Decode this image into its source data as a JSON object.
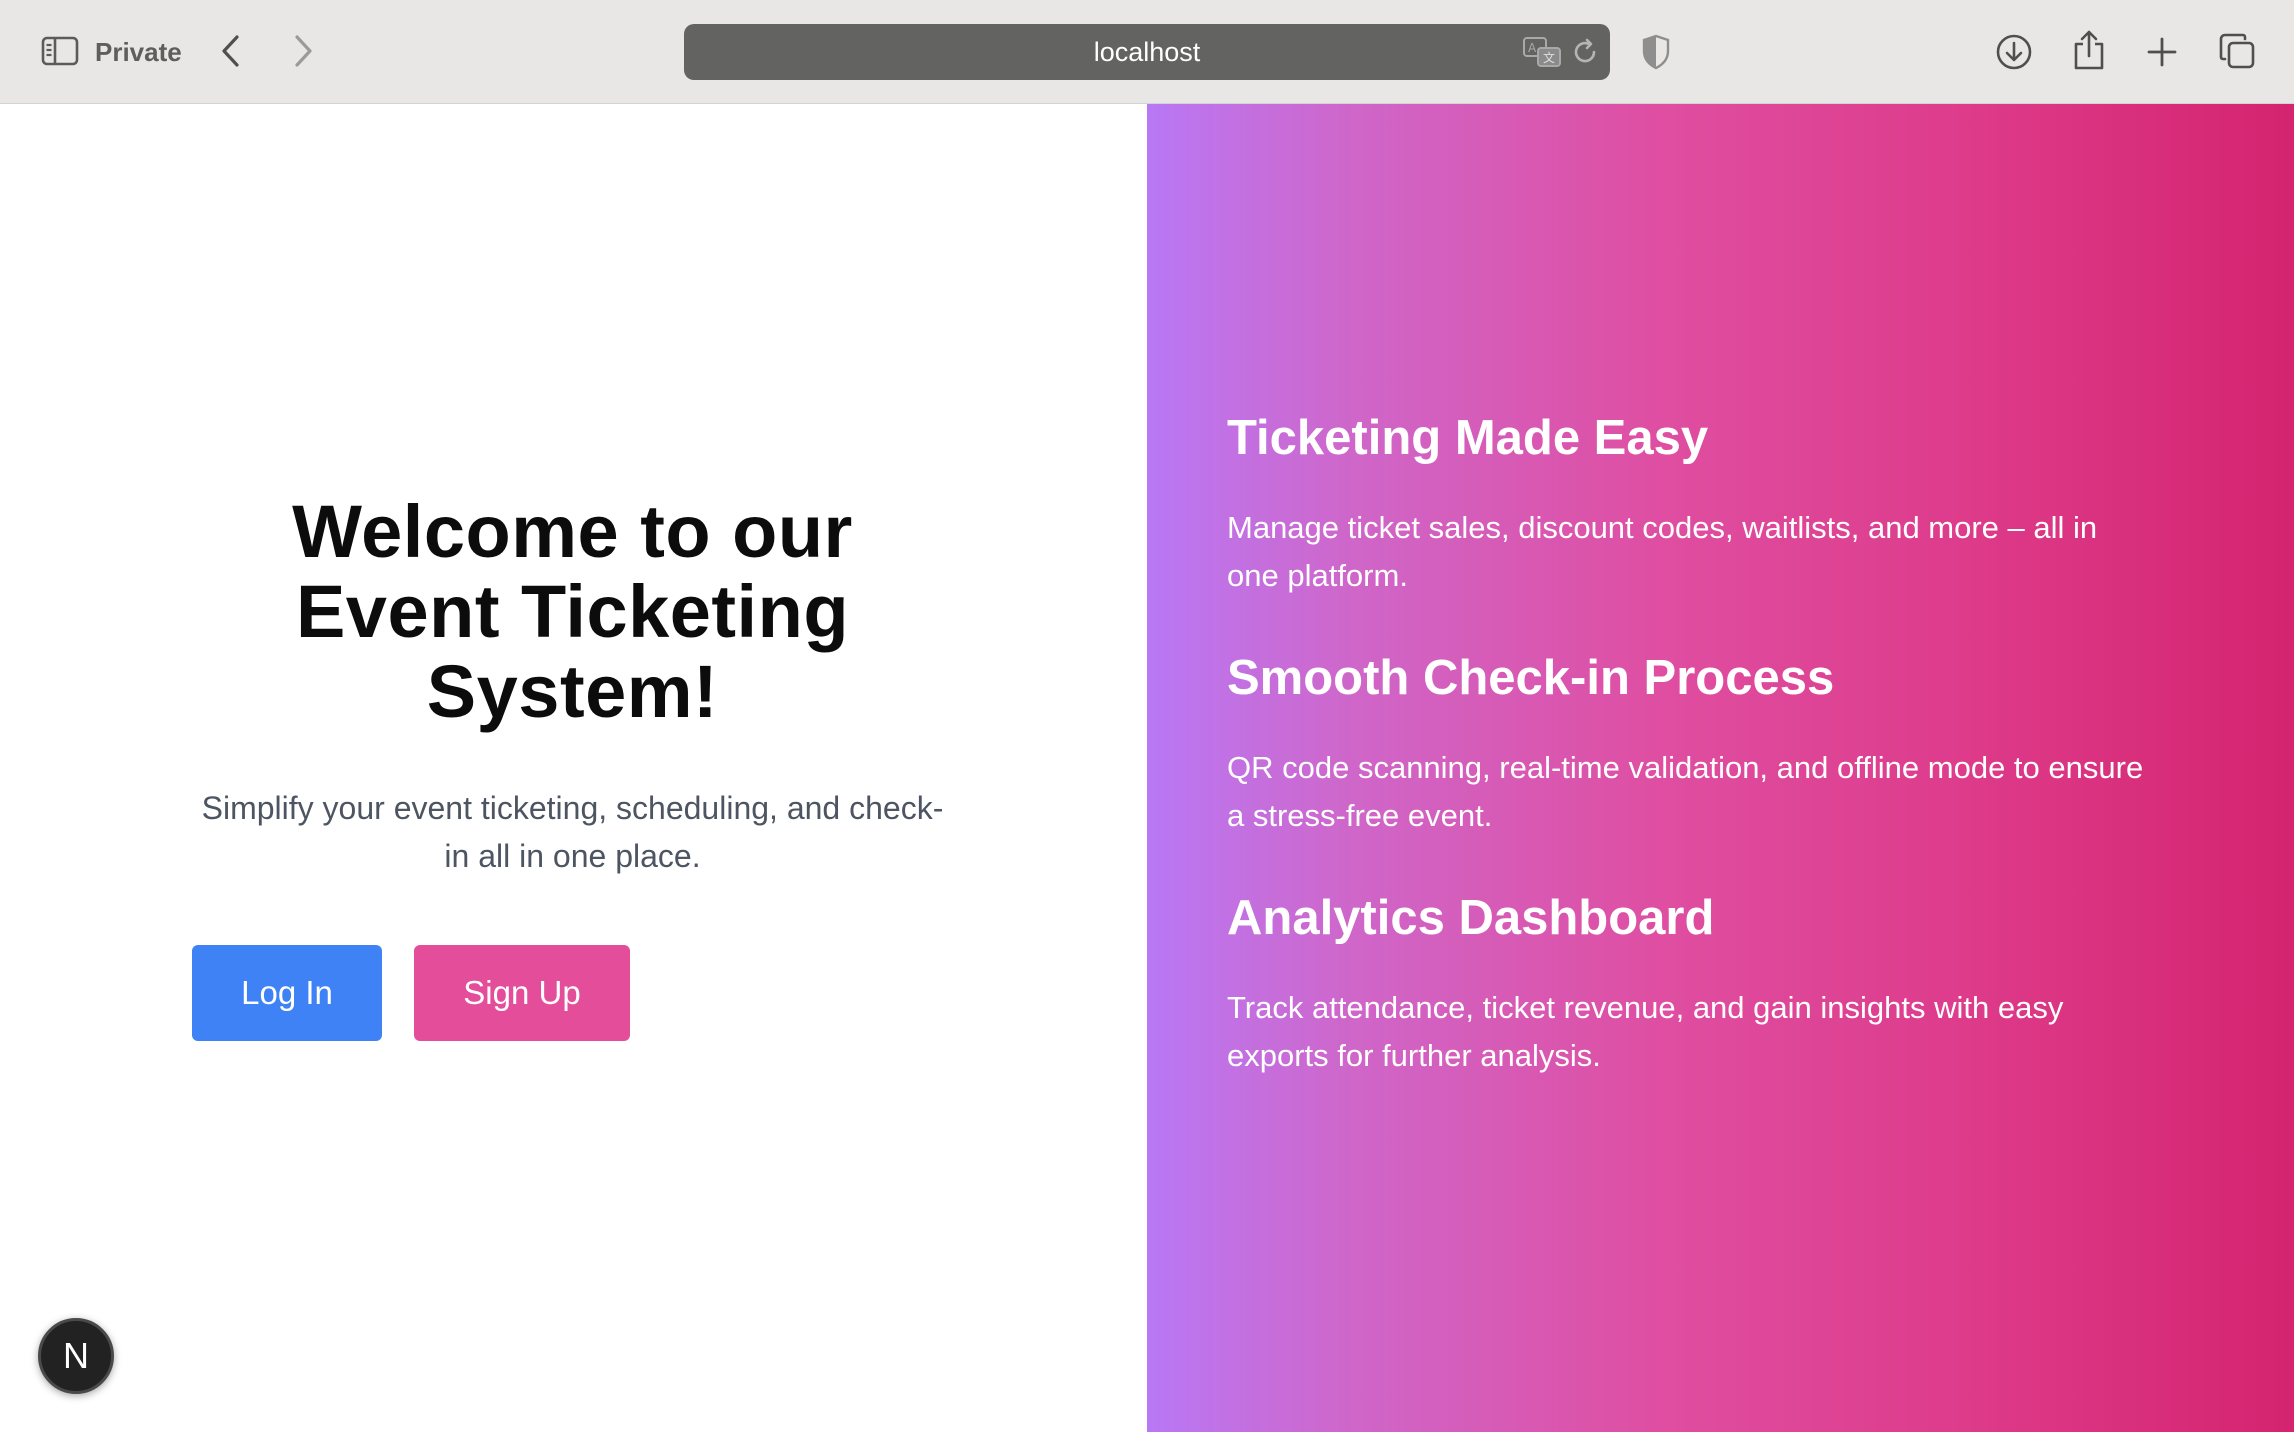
{
  "browser": {
    "private_label": "Private",
    "address": "localhost"
  },
  "hero": {
    "title": "Welcome to our Event Ticketing System!",
    "subtitle": "Simplify your event ticketing, scheduling, and check-in all in one place.",
    "login_label": "Log In",
    "signup_label": "Sign Up"
  },
  "features": [
    {
      "title": "Ticketing Made Easy",
      "description": "Manage ticket sales, discount codes, waitlists, and more – all in one platform."
    },
    {
      "title": "Smooth Check-in Process",
      "description": "QR code scanning, real-time validation, and offline mode to ensure a stress-free event."
    },
    {
      "title": "Analytics Dashboard",
      "description": "Track attendance, ticket revenue, and gain insights with easy exports for further analysis."
    }
  ],
  "dev_badge": {
    "label": "N"
  },
  "colors": {
    "login_button": "#3e82f6",
    "signup_button": "#e44d9a",
    "gradient_start": "#b878f5",
    "gradient_end": "#d4246f"
  },
  "icons": {
    "sidebar": "sidebar-icon",
    "back": "chevron-left-icon",
    "forward": "chevron-right-icon",
    "translate": "translate-icon",
    "reload": "reload-icon",
    "shield": "shield-icon",
    "download": "download-icon",
    "share": "share-icon",
    "new_tab": "plus-icon",
    "tabs": "tabs-overview-icon"
  }
}
